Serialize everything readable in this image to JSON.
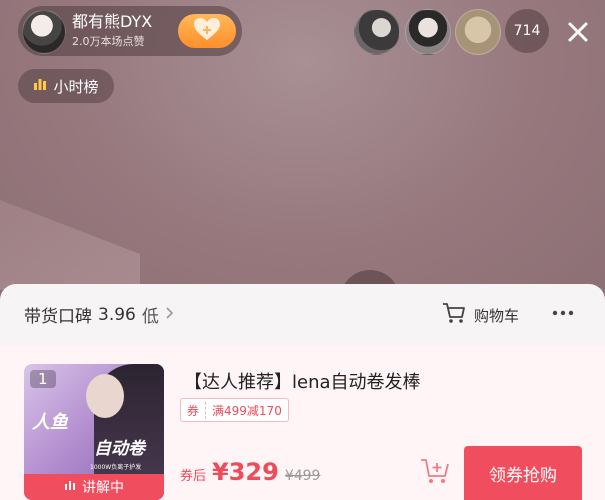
{
  "host": {
    "name": "都有熊DYX",
    "likes": "2.0万本场点赞"
  },
  "viewers": {
    "count": "714"
  },
  "rank": {
    "label": "小时榜"
  },
  "sheet": {
    "rating_label": "带货口碑",
    "rating_score": "3.96",
    "rating_level": "低",
    "cart_label": "购物车",
    "more_label": "···"
  },
  "product": {
    "rank_number": "1",
    "thumb_text_1": "人鱼",
    "thumb_text_2": "自动卷",
    "thumb_text_3": "1000W负离子护发",
    "explaining_label": "讲解中",
    "title": "【达人推荐】lena自动卷发棒",
    "coupon_label": "券",
    "coupon_desc": "满499减170",
    "price_prefix": "券后",
    "price": "¥329",
    "original_price": "¥499",
    "buy_label": "领券抢购"
  },
  "colors": {
    "accent": "#f04e5e",
    "follow": "#ff9f3a"
  }
}
